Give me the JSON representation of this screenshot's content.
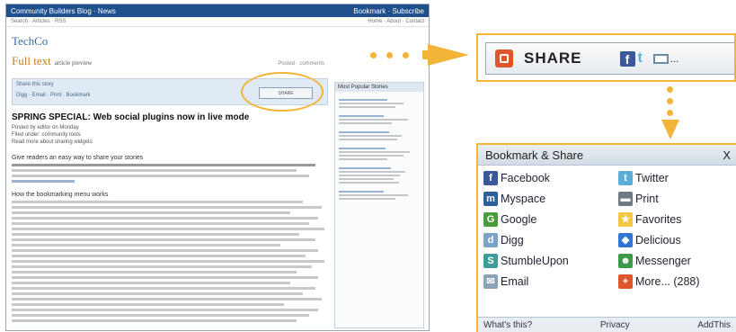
{
  "page": {
    "topbar_left": "Community Builders Blog · News",
    "topbar_right": "Bookmark · Subscribe",
    "sub_left": "Search · Articles · RSS",
    "sub_right": "Home · About · Contact",
    "logo": "TechCo",
    "headline": "Full text",
    "headline_small": "article preview",
    "headline_right": "Posted · comments",
    "toolstrip_line1": "Share this story",
    "toolstrip_line2": "Digg · Email · Print · Bookmark",
    "share_mini_label": "SHARE",
    "article_title": "SPRING SPECIAL: Web social plugins now in live mode",
    "article_meta_1": "Posted by editor on Monday",
    "article_meta_2": "Filed under: community tools",
    "article_meta_3": "Read more about sharing widgets",
    "para_title_1": "Give readers an easy way to share your stories",
    "para_title_2": "How the bookmarking menu works",
    "sidebar_head": "Most Popular Stories"
  },
  "share_bar": {
    "label": "SHARE",
    "icon_fb": "f",
    "icon_tw": "t",
    "more": "..."
  },
  "bookmark_panel": {
    "title": "Bookmark & Share",
    "close": "X",
    "items": [
      {
        "label": "Facebook",
        "icon": "facebook-icon",
        "color": "#3b5998",
        "glyph": "f"
      },
      {
        "label": "Twitter",
        "icon": "twitter-icon",
        "color": "#5aaed8",
        "glyph": "t"
      },
      {
        "label": "Myspace",
        "icon": "myspace-icon",
        "color": "#2d5f9a",
        "glyph": "m"
      },
      {
        "label": "Print",
        "icon": "print-icon",
        "color": "#6f7a85",
        "glyph": "▬"
      },
      {
        "label": "Google",
        "icon": "google-icon",
        "color": "#4a9c3a",
        "glyph": "G"
      },
      {
        "label": "Favorites",
        "icon": "favorites-icon",
        "color": "#f2c744",
        "glyph": "★"
      },
      {
        "label": "Digg",
        "icon": "digg-icon",
        "color": "#7aa3c7",
        "glyph": "d"
      },
      {
        "label": "Delicious",
        "icon": "delicious-icon",
        "color": "#3274d1",
        "glyph": "◆"
      },
      {
        "label": "StumbleUpon",
        "icon": "stumbleupon-icon",
        "color": "#3f9c9a",
        "glyph": "S"
      },
      {
        "label": "Messenger",
        "icon": "messenger-icon",
        "color": "#3a9a4a",
        "glyph": "☻"
      },
      {
        "label": "Email",
        "icon": "email-icon",
        "color": "#8ba2b8",
        "glyph": "✉"
      },
      {
        "label": "More... (288)",
        "icon": "more-icon",
        "color": "#e0562b",
        "glyph": "+"
      }
    ],
    "footer_left": "What's this?",
    "footer_mid": "Privacy",
    "footer_right": "AddThis"
  },
  "colors": {
    "accent": "#f2b53a",
    "header_blue": "#1f4f8c",
    "share_orange": "#e0562b"
  }
}
